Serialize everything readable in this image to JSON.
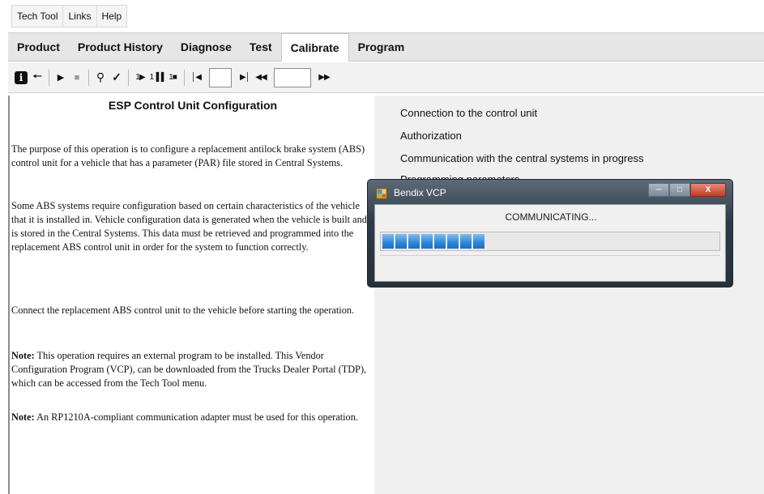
{
  "menu": {
    "items": [
      "Tech Tool",
      "Links",
      "Help"
    ]
  },
  "tabs": {
    "items": [
      "Product",
      "Product History",
      "Diagnose",
      "Test",
      "Calibrate",
      "Program"
    ],
    "active_index": 4
  },
  "toolbar": {
    "icons": [
      "info-icon",
      "back-arrow-icon",
      "play-icon",
      "stop-icon",
      "probe-icon",
      "check-icon",
      "step-into-icon",
      "step-over-icon",
      "step-out-icon",
      "first-icon",
      "last-icon",
      "rewind-icon",
      "fast-forward-icon"
    ],
    "step_field_value": "",
    "jump_field_value": ""
  },
  "document": {
    "title": "ESP Control Unit Configuration",
    "p1": "The purpose of this operation is to configure a replacement antilock brake system (ABS) control unit for a vehicle that has a parameter (PAR) file stored in Central Systems.",
    "p2": "Some ABS systems require configuration based on certain characteristics of the vehicle that it is installed in. Vehicle configuration data is generated when the vehicle is built and is stored in the Central Systems. This data must be retrieved and programmed into the replacement ABS control unit in order for the system to function correctly.",
    "p3": "Connect the replacement ABS control unit to the vehicle before starting the operation.",
    "note_label": "Note:",
    "note1": " This operation requires an external program to be installed. This Vendor Configuration Program (VCP), can be downloaded from the Trucks Dealer Portal (TDP), which can be accessed from the Tech Tool menu.",
    "note2": " An RP1210A-compliant communication adapter must be used for this operation."
  },
  "steps": [
    "Connection to the control unit",
    "Authorization",
    "Communication with the central systems in progress",
    "Programming parameters"
  ],
  "dialog": {
    "title": "Bendix VCP",
    "status": "COMMUNICATING...",
    "progress_blocks_filled": 8,
    "progress_fraction": 0.28,
    "accent": "#2b86d9"
  }
}
